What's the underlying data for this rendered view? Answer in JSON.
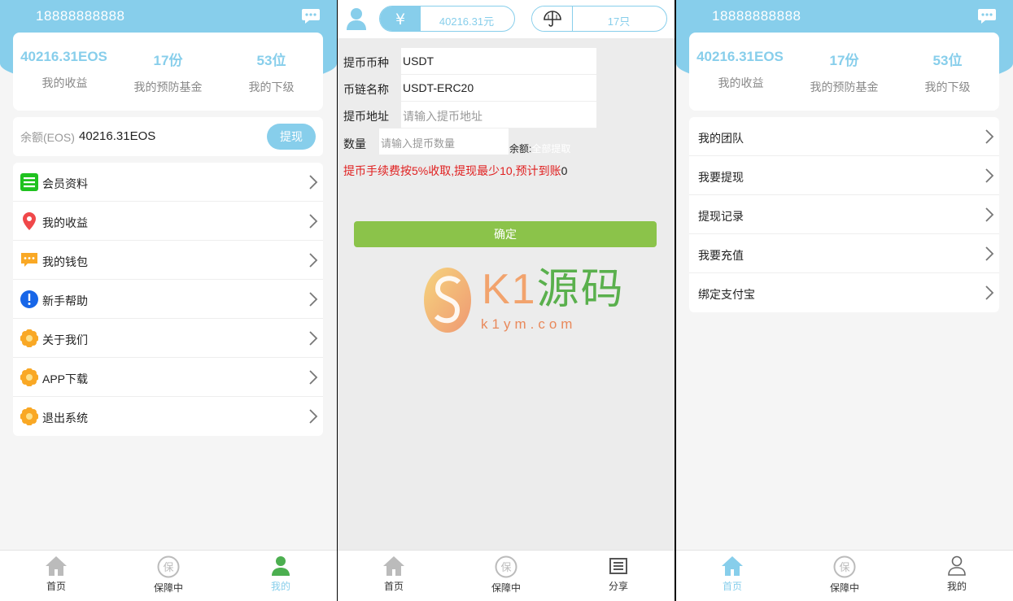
{
  "panel1": {
    "phone": "18888888888",
    "stats": [
      {
        "value": "40216.31EOS",
        "label": "我的收益"
      },
      {
        "value": "17份",
        "label": "我的预防基金"
      },
      {
        "value": "53位",
        "label": "我的下级"
      }
    ],
    "balance": {
      "label": "余额(EOS)",
      "value": "40216.31EOS",
      "button": "提现"
    },
    "menu": [
      {
        "label": "会员资料",
        "icon": "list-icon"
      },
      {
        "label": "我的收益",
        "icon": "location-pin-icon"
      },
      {
        "label": "我的钱包",
        "icon": "wallet-icon"
      },
      {
        "label": "新手帮助",
        "icon": "info-icon"
      },
      {
        "label": "关于我们",
        "icon": "flower-icon"
      },
      {
        "label": "APP下载",
        "icon": "flower-icon"
      },
      {
        "label": "退出系统",
        "icon": "flower-icon"
      }
    ],
    "nav": [
      {
        "label": "首页",
        "icon": "home-icon"
      },
      {
        "label": "保障中",
        "icon": "shield-bao-icon"
      },
      {
        "label": "我的",
        "icon": "user-icon"
      }
    ]
  },
  "panel2": {
    "money_value": "40216.31元",
    "insurance_value": "17只",
    "form": {
      "coin_type_label": "提币币种",
      "coin_type_value": "USDT",
      "chain_label": "币链名称",
      "chain_value": "USDT-ERC20",
      "address_label": "提币地址",
      "address_placeholder": "请输入提币地址",
      "qty_label": "数量",
      "qty_placeholder": "请输入提币数量",
      "balance_label": "余额:",
      "withdraw_all": "全部提取"
    },
    "fee_note": "提币手续费按5%收取,提现最少10,预计到账",
    "fee_amount": "0",
    "confirm": "确定",
    "watermark": {
      "brand_k1": "K1",
      "brand_cn": "源码",
      "url": "k1ym.com"
    },
    "nav": [
      {
        "label": "首页",
        "icon": "home-icon"
      },
      {
        "label": "保障中",
        "icon": "shield-bao-icon"
      },
      {
        "label": "分享",
        "icon": "share-list-icon"
      }
    ]
  },
  "panel3": {
    "phone": "18888888888",
    "stats": [
      {
        "value": "40216.31EOS",
        "label": "我的收益"
      },
      {
        "value": "17份",
        "label": "我的预防基金"
      },
      {
        "value": "53位",
        "label": "我的下级"
      }
    ],
    "menu": [
      {
        "label": "我的团队"
      },
      {
        "label": "我要提现"
      },
      {
        "label": "提现记录"
      },
      {
        "label": "我要充值"
      },
      {
        "label": "绑定支付宝"
      }
    ],
    "nav": [
      {
        "label": "首页",
        "icon": "home-icon"
      },
      {
        "label": "保障中",
        "icon": "shield-bao-icon"
      },
      {
        "label": "我的",
        "icon": "user-outline-icon"
      }
    ]
  },
  "colors": {
    "accent": "#87ceeb",
    "confirm": "#8bc34a",
    "warning": "#e02020"
  }
}
